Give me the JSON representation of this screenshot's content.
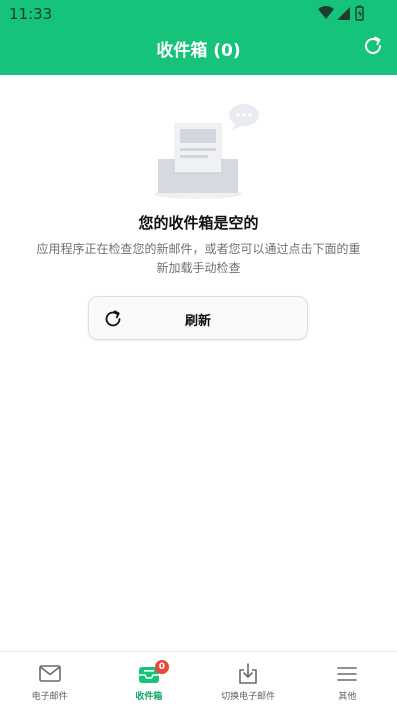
{
  "status_bar": {
    "time": "11:33"
  },
  "header": {
    "title": "收件箱 (0)",
    "refresh_icon": "refresh-icon"
  },
  "empty_state": {
    "illustration": "empty-inbox-illustration",
    "title": "您的收件箱是空的",
    "description": "应用程序正在检查您的新邮件，或者您可以通过点击下面的重新加载手动检查",
    "button_label": "刷新",
    "button_icon": "refresh-icon"
  },
  "bottom_nav": {
    "items": [
      {
        "label": "电子邮件",
        "icon": "mail-icon",
        "active": false
      },
      {
        "label": "收件箱",
        "icon": "inbox-icon",
        "active": true,
        "badge": "0"
      },
      {
        "label": "切换电子邮件",
        "icon": "download-icon",
        "active": false
      },
      {
        "label": "其他",
        "icon": "menu-icon",
        "active": false
      }
    ]
  },
  "colors": {
    "brand": "#15c37a",
    "active_tab": "#15a86a",
    "badge": "#e8483c"
  }
}
